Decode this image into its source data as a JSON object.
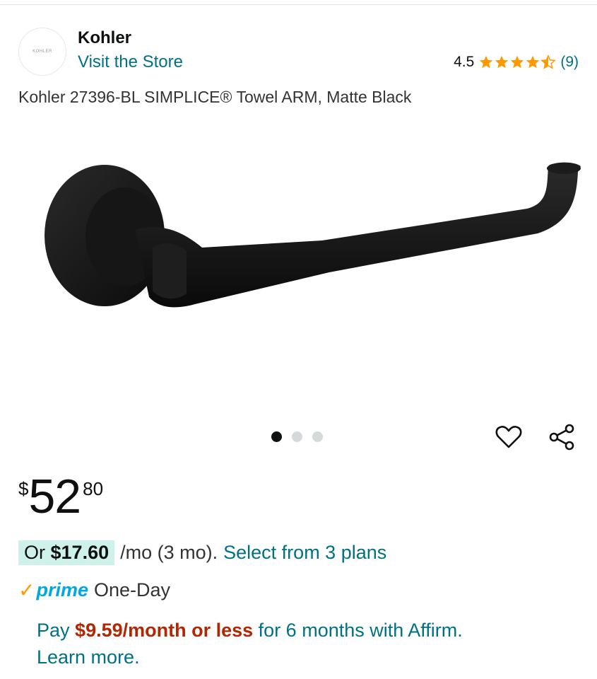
{
  "brand": {
    "name": "Kohler",
    "logo_text": "KOHLER",
    "store_link": "Visit the Store"
  },
  "rating": {
    "value": "4.5",
    "stars": 4.5,
    "count": "(9)",
    "star_color": "#ff9900"
  },
  "product": {
    "title": "Kohler 27396-BL SIMPLICE® Towel ARM, Matte Black"
  },
  "carousel": {
    "total": 3,
    "active_index": 0
  },
  "actions": {
    "favorite_icon": "heart-icon",
    "share_icon": "share-icon"
  },
  "price": {
    "symbol": "$",
    "whole": "52",
    "fraction": "80"
  },
  "installments": {
    "prefix": "Or",
    "amount": "$17.60",
    "term": "/mo (3 mo).",
    "plans_link": "Select from 3 plans"
  },
  "delivery": {
    "check": "✓",
    "prime_label": "prime",
    "speed": "One-Day"
  },
  "affirm": {
    "pay": "Pay",
    "amount": "$9.59/month or less",
    "rest": "for 6 months with Affirm.",
    "learn_more": "Learn more."
  },
  "colors": {
    "link": "#007185",
    "price_red": "#b12704",
    "prime_blue": "#00a8e1",
    "highlight": "#cef2e9"
  }
}
